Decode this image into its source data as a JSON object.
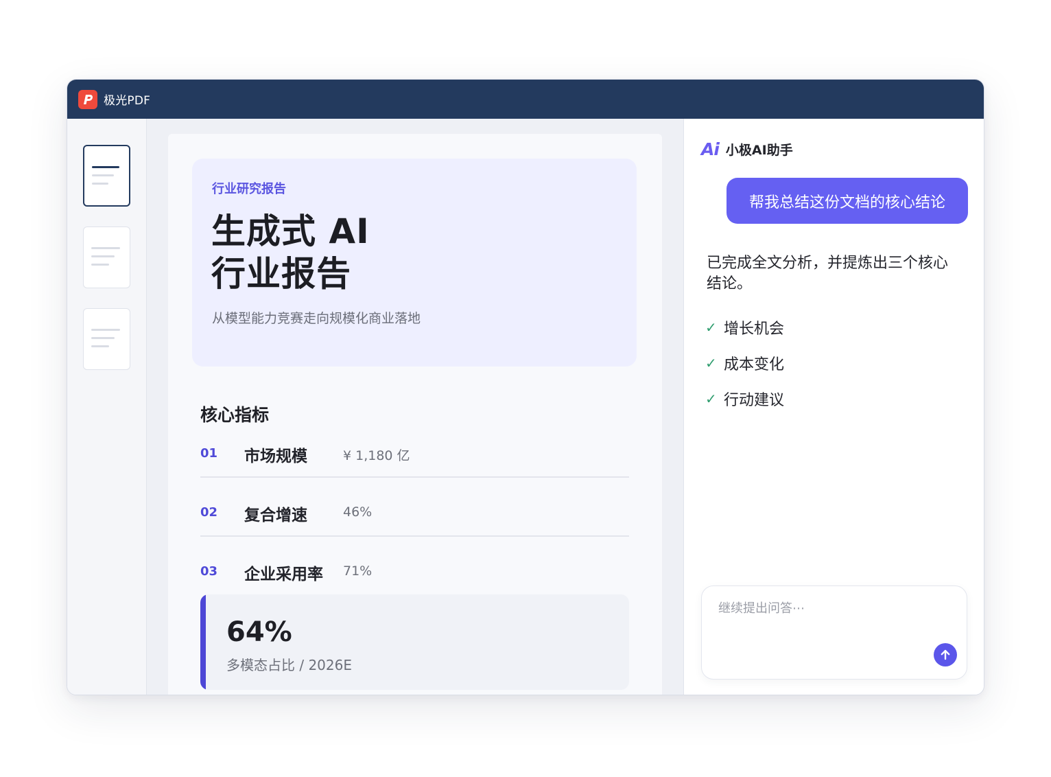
{
  "app": {
    "title": "极光PDF",
    "logo_icon": "pdf-logo-icon",
    "logo_color": "#ef4a3c",
    "titlebar_color": "#233a5e"
  },
  "document": {
    "hero": {
      "kicker": "行业研究报告",
      "title_line1": "生成式 AI",
      "title_line2": "行业报告",
      "subtitle": "从模型能力竞赛走向规模化商业落地"
    },
    "metrics_heading": "核心指标",
    "metrics": [
      {
        "num": "01",
        "label": "市场规模",
        "value": "¥ 1,180 亿"
      },
      {
        "num": "02",
        "label": "复合增速",
        "value": "46%"
      },
      {
        "num": "03",
        "label": "企业采用率",
        "value": "71%"
      }
    ],
    "highlight": {
      "value": "64%",
      "caption": "多模态占比 / 2026E"
    }
  },
  "assistant": {
    "logo_text": "Ai",
    "name": "小极AI助手",
    "user_message": "帮我总结这份文档的核心结论",
    "reply": "已完成全文分析，并提炼出三个核心结论。",
    "points": [
      "增长机会",
      "成本变化",
      "行动建议"
    ],
    "input_placeholder": "继续提出问答⋯",
    "accent_color": "#6560f2"
  }
}
